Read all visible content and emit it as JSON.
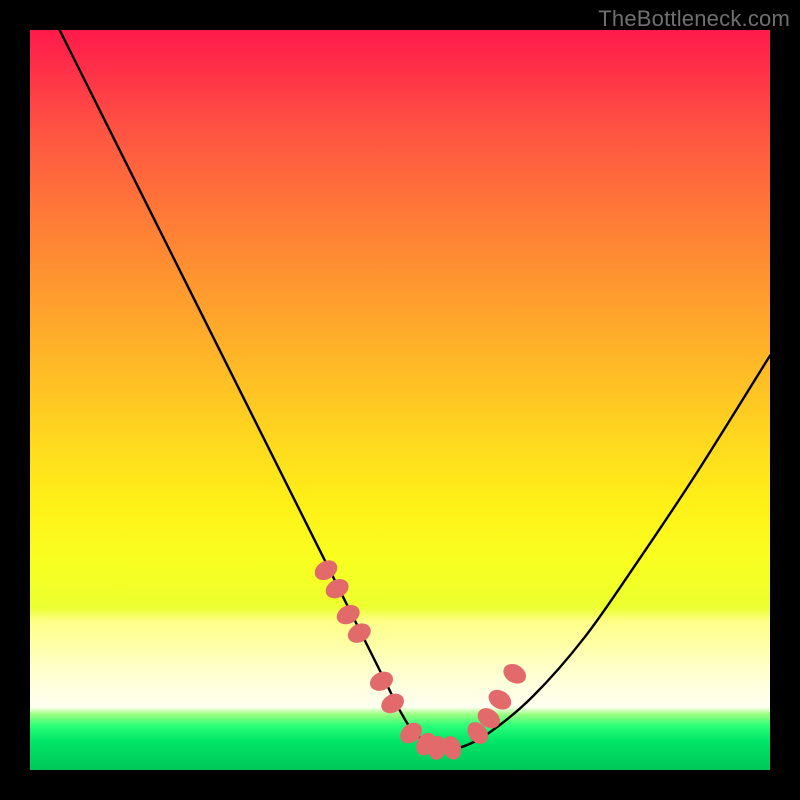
{
  "watermark": "TheBottleneck.com",
  "colors": {
    "page_bg": "#000000",
    "curve": "#000000",
    "bead": "#e26a6a",
    "gradient_top": "#ff1a4a",
    "gradient_bottom": "#00c858"
  },
  "chart_data": {
    "type": "line",
    "title": "",
    "xlabel": "",
    "ylabel": "",
    "xlim": [
      0,
      100
    ],
    "ylim": [
      0,
      100
    ],
    "grid": false,
    "legend": false,
    "annotations": [
      "TheBottleneck.com"
    ],
    "series": [
      {
        "name": "bottleneck-curve",
        "x": [
          0,
          5,
          10,
          15,
          20,
          25,
          30,
          35,
          40,
          45,
          48,
          50,
          52,
          55,
          58,
          62,
          68,
          75,
          82,
          90,
          100
        ],
        "y": [
          108,
          98,
          88,
          78,
          68,
          58,
          48,
          38,
          28,
          18,
          12,
          8,
          5,
          3,
          3,
          5,
          10,
          18,
          28,
          40,
          56
        ]
      },
      {
        "name": "bead-markers",
        "x": [
          40.0,
          41.5,
          43.0,
          44.5,
          47.5,
          49.0,
          51.5,
          53.5,
          55.0,
          57.0,
          60.5,
          62.0,
          63.5,
          65.5
        ],
        "y": [
          27.0,
          24.5,
          21.0,
          18.5,
          12.0,
          9.0,
          5.0,
          3.5,
          3.0,
          3.0,
          5.0,
          7.0,
          9.5,
          13.0
        ]
      }
    ]
  }
}
